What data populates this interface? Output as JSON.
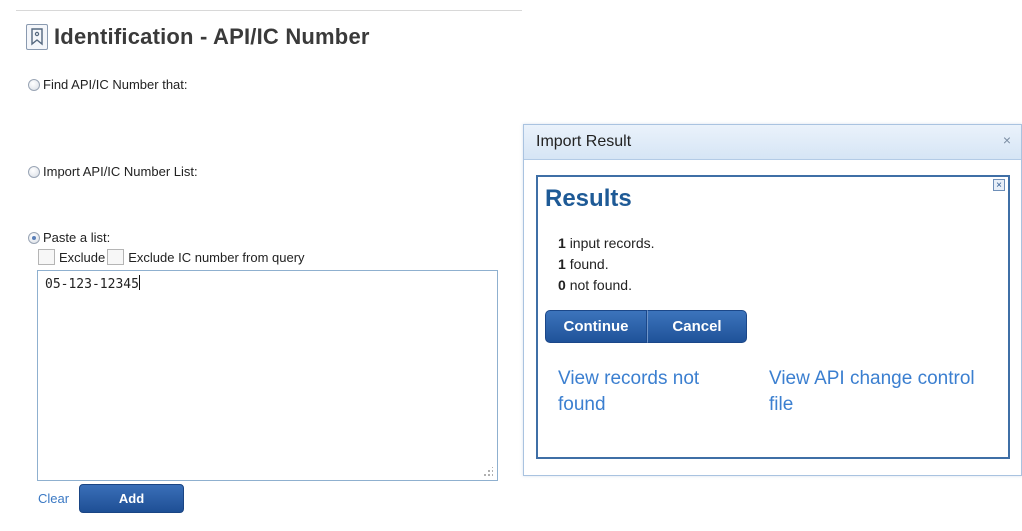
{
  "page": {
    "title": "Identification - API/IC Number",
    "options": {
      "find_label": "Find API/IC Number that:",
      "import_label": "Import API/IC Number List:",
      "paste_label": "Paste a list:"
    },
    "checkboxes": {
      "exclude_label": "Exclude",
      "exclude_ic_label": "Exclude IC number from query"
    },
    "paste_value": "05-123-12345",
    "clear_label": "Clear",
    "add_label": "Add"
  },
  "dialog": {
    "title": "Import Result",
    "close_glyph": "×",
    "inner_close_glyph": "×",
    "heading": "Results",
    "stats": {
      "input_count": "1",
      "input_text": "input records.",
      "found_count": "1",
      "found_text": "found.",
      "not_found_count": "0",
      "not_found_text": "not found."
    },
    "continue_label": "Continue",
    "cancel_label": "Cancel",
    "links": {
      "not_found_line1": "View records not",
      "not_found_line2": "found",
      "change_control_line1": "View API change control",
      "change_control_line2": "file"
    }
  },
  "colors": {
    "accent": "#1e5a96",
    "button": "#2a5fa8",
    "link": "#3b7fd0"
  },
  "icons": {
    "title": "bookmark-icon",
    "dialog_close": "close-icon",
    "panel_close": "close-icon"
  }
}
